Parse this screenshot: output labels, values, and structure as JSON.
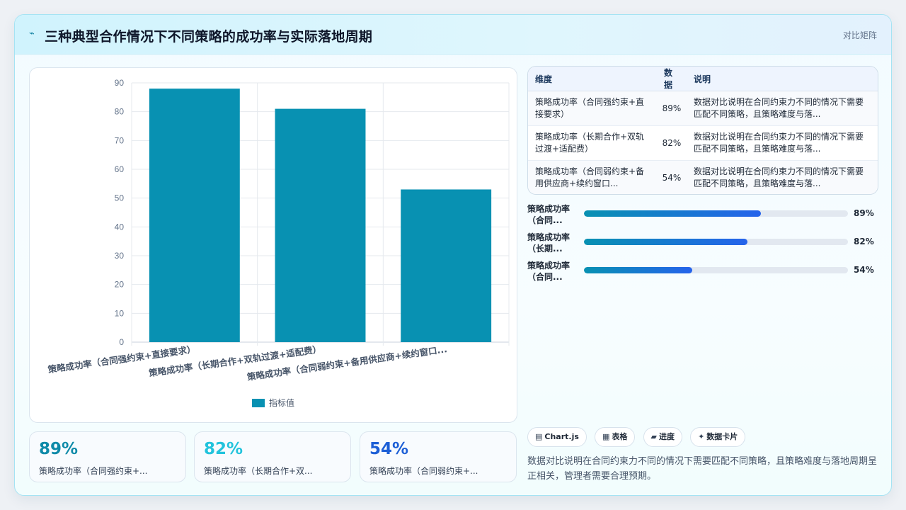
{
  "header": {
    "logo_icon": "trend-icon",
    "title": "三种典型合作情况下不同策略的成功率与实际落地周期",
    "tag": "对比矩阵"
  },
  "chart_data": {
    "type": "bar",
    "categories": [
      "策略成功率（合同强约束+直接要求）",
      "策略成功率（长期合作+双轨过渡+适配费）",
      "策略成功率（合同弱约束+备用供应商+续约窗口..."
    ],
    "series": [
      {
        "name": "指标值",
        "values": [
          88,
          81,
          53
        ],
        "color": "#0891b2"
      }
    ],
    "ylim": [
      0,
      90
    ],
    "yticks": [
      0,
      10,
      20,
      30,
      40,
      50,
      60,
      70,
      80,
      90
    ],
    "grid": true,
    "legend": "bottom"
  },
  "kpis": [
    {
      "value": "89%",
      "label": "策略成功率（合同强约束+...",
      "color": "#0e8aa8"
    },
    {
      "value": "82%",
      "label": "策略成功率（长期合作+双...",
      "color": "#22c3dc"
    },
    {
      "value": "54%",
      "label": "策略成功率（合同弱约束+...",
      "color": "#1d5fd6"
    }
  ],
  "table": {
    "headers": [
      "维度",
      "数据",
      "说明"
    ],
    "rows": [
      {
        "dim": "策略成功率（合同强约束+直接要求）",
        "data": "89%",
        "note": "数据对比说明在合同约束力不同的情况下需要匹配不同策略，且策略难度与落..."
      },
      {
        "dim": "策略成功率（长期合作+双轨过渡+适配费）",
        "data": "82%",
        "note": "数据对比说明在合同约束力不同的情况下需要匹配不同策略，且策略难度与落..."
      },
      {
        "dim": "策略成功率（合同弱约束+备用供应商+续约窗口...",
        "data": "54%",
        "note": "数据对比说明在合同约束力不同的情况下需要匹配不同策略，且策略难度与落..."
      }
    ]
  },
  "progress": [
    {
      "label": "策略成功率（合同...",
      "value": 0.67,
      "text": "89%"
    },
    {
      "label": "策略成功率（长期...",
      "value": 0.62,
      "text": "82%"
    },
    {
      "label": "策略成功率（合同...",
      "value": 0.41,
      "text": "54%"
    }
  ],
  "chips": [
    {
      "icon": "chart-icon",
      "glyph": "▤",
      "label": "Chart.js"
    },
    {
      "icon": "table-icon",
      "glyph": "▦",
      "label": "表格"
    },
    {
      "icon": "progress-icon",
      "glyph": "▰",
      "label": "进度"
    },
    {
      "icon": "sparkle-icon",
      "glyph": "✦",
      "label": "数据卡片"
    }
  ],
  "summary": "数据对比说明在合同约束力不同的情况下需要匹配不同策略，且策略难度与落地周期呈正相关，管理者需要合理预期。"
}
